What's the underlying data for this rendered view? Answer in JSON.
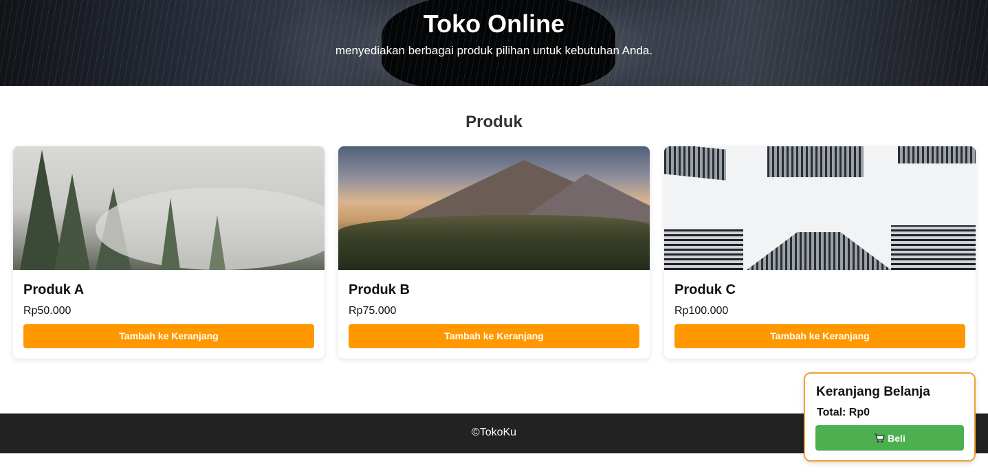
{
  "hero": {
    "title": "Toko Online",
    "subtitle": "menyediakan berbagai produk pilihan untuk kebutuhan Anda."
  },
  "products_section": {
    "title": "Produk",
    "items": [
      {
        "name": "Produk A",
        "price": "Rp50.000",
        "button_label": "Tambah ke Keranjang",
        "image": "foggy-forest-image"
      },
      {
        "name": "Produk B",
        "price": "Rp75.000",
        "button_label": "Tambah ke Keranjang",
        "image": "mountain-sunset-image"
      },
      {
        "name": "Produk C",
        "price": "Rp100.000",
        "button_label": "Tambah ke Keranjang",
        "image": "skyscrapers-image"
      }
    ]
  },
  "cart": {
    "title": "Keranjang Belanja",
    "total": "Total: Rp0",
    "buy_label": "Beli",
    "buy_icon": "shopping-cart-icon"
  },
  "footer": {
    "text": "©TokoKu"
  },
  "colors": {
    "accent": "#ff9800",
    "buy": "#4caf50",
    "footer_bg": "#222222",
    "cart_border": "#f0a030"
  }
}
